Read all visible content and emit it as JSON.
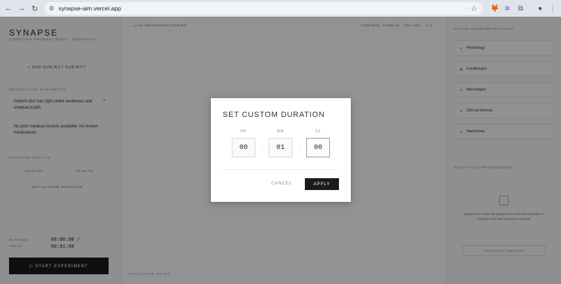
{
  "browser": {
    "url": "synapse-aim.vercel.app",
    "nav": {
      "back_icon": "←",
      "forward_icon": "→",
      "reload_icon": "↻"
    }
  },
  "app": {
    "left": {
      "logo": "SYNAPSE",
      "subtitle": "COGNITIVE NEUROSCIENCE · RESEARCH",
      "add_subject": "+ ADD SUBJECT SUBJECT",
      "observation_label": "OBSERVATION PARAMETER",
      "notes": [
        "Patient also has right-sided weakness and unequal pupils.",
        "No prior medical records available. No known medications."
      ],
      "duration_label": "DURATION PROFILE",
      "duration_options": [
        "00:00:00",
        "00:00:00"
      ],
      "custom_duration": "SET CUSTOM DURATION",
      "stats": [
        {
          "label": "ELAPSED",
          "value": "00:00:00 /"
        },
        {
          "label": "TOTAL",
          "value": "00:01:00"
        }
      ],
      "start_button": "▷ START EXPERIMENT"
    },
    "center": {
      "back_link": "← LIVE NEUROMONITORING",
      "meta": "CONTROL STREAM · 000.000 · 0.0",
      "footer": "SIMULATION READY"
    },
    "right": {
      "title": "ACTIVE NEUROMETRIC DATA",
      "channels": [
        {
          "label": "Physiology",
          "color": "#bdbdbd"
        },
        {
          "label": "Cardiologist",
          "color": "#d24a4a"
        },
        {
          "label": "Neurologist",
          "color": "#bdbdbd"
        },
        {
          "label": "Clinical Ethicist",
          "color": "#bdbdbd"
        },
        {
          "label": "Statistician",
          "color": "#bdbdbd"
        }
      ],
      "analysis_title": "ANALYTICAL PROGRESSION",
      "analysis_text": "Experiment results will appear here once the simulation is complete and data has been collected.",
      "analysis_button": "GENERATE REPORT"
    }
  },
  "modal": {
    "title": "SET CUSTOM DURATION",
    "labels": {
      "hh": "HH",
      "mm": "MM",
      "ss": "SS"
    },
    "values": {
      "hh": "00",
      "mm": "01",
      "ss": "00"
    },
    "separator": ":",
    "cancel": "CANCEL",
    "apply": "APPLY"
  }
}
